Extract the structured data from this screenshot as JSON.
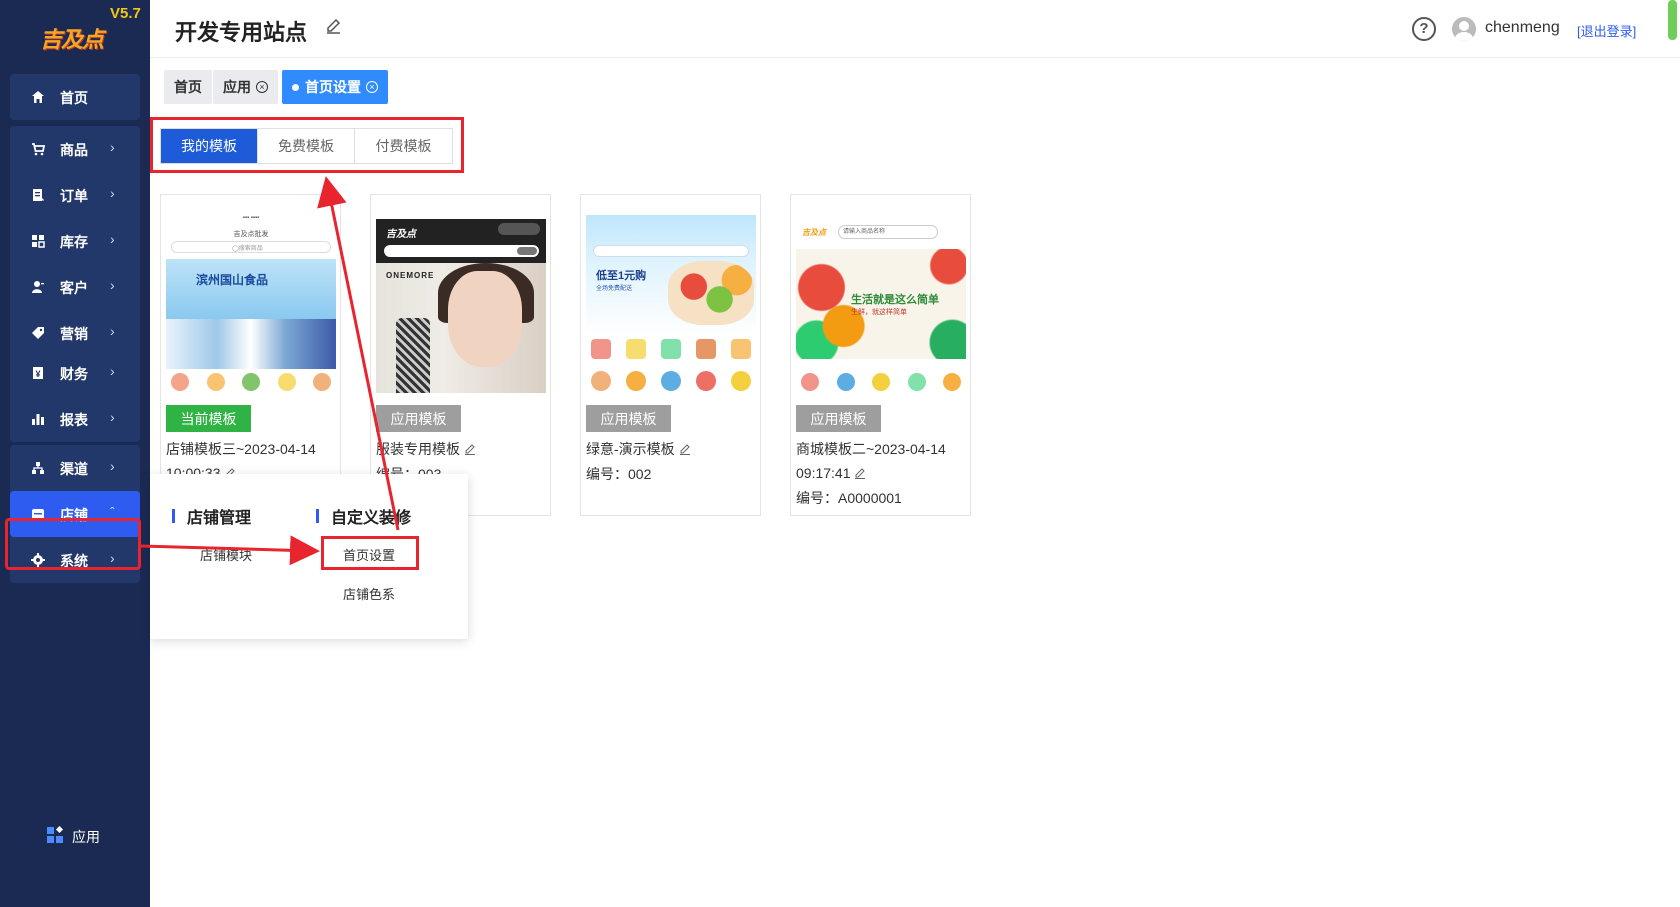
{
  "sidebar": {
    "version": "V5.7",
    "logo_text": "吉及点",
    "items": [
      {
        "label": "首页"
      },
      {
        "label": "商品"
      },
      {
        "label": "订单"
      },
      {
        "label": "库存"
      },
      {
        "label": "客户"
      },
      {
        "label": "营销"
      },
      {
        "label": "财务"
      },
      {
        "label": "报表"
      },
      {
        "label": "渠道"
      },
      {
        "label": "店铺"
      },
      {
        "label": "系统"
      }
    ],
    "apps_label": "应用"
  },
  "header": {
    "site_title": "开发专用站点",
    "help": "?",
    "username": "chenmeng",
    "logout": "[退出登录]"
  },
  "breadcrumb": [
    {
      "label": "首页"
    },
    {
      "label": "应用"
    },
    {
      "label": "首页设置"
    }
  ],
  "template_tabs": [
    {
      "label": "我的模板"
    },
    {
      "label": "免费模板"
    },
    {
      "label": "付费模板"
    }
  ],
  "cards": [
    {
      "button": "当前模板",
      "name_line1": "店铺模板三~2023-04-14",
      "name_line2": "10:00:33",
      "code": ""
    },
    {
      "button": "应用模板",
      "name_line1": "服装专用模板",
      "name_line2": "",
      "code": "编号：003"
    },
    {
      "button": "应用模板",
      "name_line1": "绿意-演示模板",
      "name_line2": "",
      "code": "编号：002"
    },
    {
      "button": "应用模板",
      "name_line1": "商城模板二~2023-04-14",
      "name_line2": "09:17:41",
      "code": "编号：A0000001"
    }
  ],
  "thumb_text": {
    "t1_title": "吉及点批发",
    "t1_search": "◯搜索商品",
    "t1_banner": "滨州国山食品",
    "t2_logo": "吉及点",
    "t2_brand": "ONEMORE",
    "t3_promo": "低至1元购",
    "t3_promo_sub": "全场免费配送",
    "t4_logo": "吉及点",
    "t4_search": "请输入商品名称",
    "t4_slogan": "生活就是这么简单",
    "t4_slogan_sub": "生鲜，就这样简单"
  },
  "popup": {
    "section1_title": "店铺管理",
    "section1_link": "店铺模块",
    "section2_title": "自定义装修",
    "section2_links": [
      "首页设置",
      "店铺色系"
    ]
  },
  "colors": {
    "sidebar_bg": "#1b2a52",
    "active_blue": "#2f5cf0",
    "current_green": "#2fb344",
    "annotation_red": "#e8242e"
  }
}
